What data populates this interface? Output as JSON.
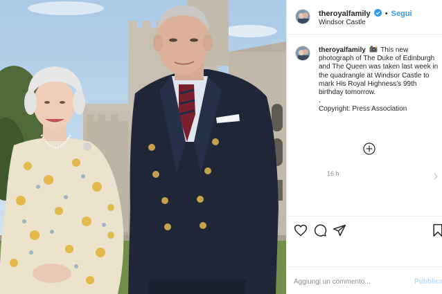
{
  "photo": {
    "alt": "The Duke of Edinburgh and The Queen at Windsor Castle"
  },
  "post_header": {
    "username": "theroyalfamily",
    "separator": "•",
    "follow_label": "Segui",
    "location": "Windsor Castle",
    "avatar_icon": "royal-family-avatar-icon",
    "verified_icon": "verified-badge-icon"
  },
  "caption": {
    "username": "theroyalfamily",
    "emoji_icon": "camera-with-flash-icon",
    "text_main": "This new photograph of The Duke of Edinburgh and The Queen was taken last week in the quadrangle at Windsor Castle to mark His Royal Highness's 99th birthday tomorrow.",
    "text_dot": ".",
    "text_copyright": "Copyright: Press Association",
    "time_ago": "16 h"
  },
  "controls": {
    "load_more_icon": "plus-circle-icon",
    "next_icon": "chevron-right-icon"
  },
  "actions": {
    "like_icon": "heart-icon",
    "comment_icon": "comment-icon",
    "share_icon": "paper-plane-icon",
    "save_icon": "bookmark-icon"
  },
  "add_comment": {
    "placeholder": "Aggiungi un commento...",
    "publish_label": "Pubblica"
  },
  "colors": {
    "accent": "#3897f0",
    "publish_disabled": "#b2dffc",
    "text": "#262626",
    "muted": "#8e8e8e",
    "border": "#efefef"
  }
}
